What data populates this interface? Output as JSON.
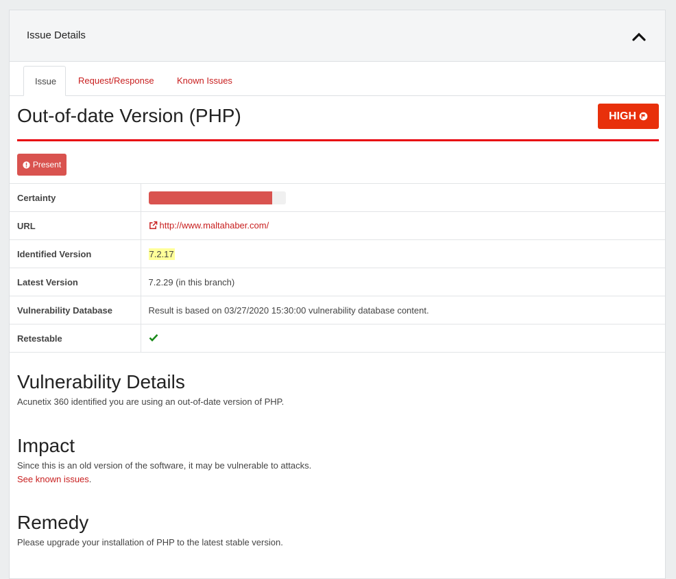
{
  "panel": {
    "title": "Issue Details"
  },
  "tabs": [
    {
      "label": "Issue"
    },
    {
      "label": "Request/Response"
    },
    {
      "label": "Known Issues"
    }
  ],
  "issue": {
    "title": "Out-of-date Version (PHP)",
    "severity": "HIGH",
    "status": "Present"
  },
  "details": {
    "certainty_label": "Certainty",
    "certainty_value": 0.9,
    "url_label": "URL",
    "url_value": "http://www.maltahaber.com/",
    "identified_label": "Identified Version",
    "identified_value": "7.2.17",
    "latest_label": "Latest Version",
    "latest_value": "7.2.29 (in this branch)",
    "vulndb_label": "Vulnerability Database",
    "vulndb_value": "Result is based on 03/27/2020 15:30:00 vulnerability database content.",
    "retestable_label": "Retestable"
  },
  "sections": {
    "vuln_title": "Vulnerability Details",
    "vuln_text": "Acunetix 360 identified you are using an out-of-date version of PHP.",
    "impact_title": "Impact",
    "impact_text": "Since this is an old version of the software, it may be vulnerable to attacks.",
    "impact_link": "See known issues",
    "impact_link_suffix": ".",
    "remedy_title": "Remedy",
    "remedy_text": "Please upgrade your installation of PHP to the latest stable version."
  },
  "colors": {
    "accent": "#c81e1e",
    "severity_high": "#e8300b",
    "present": "#d9534f",
    "check": "#1a8a1a"
  },
  "icons": {
    "collapse": "chevron-up-icon",
    "severity": "flag-circle-icon",
    "status": "exclamation-circle-icon",
    "url": "external-link-icon",
    "retestable": "check-icon"
  }
}
